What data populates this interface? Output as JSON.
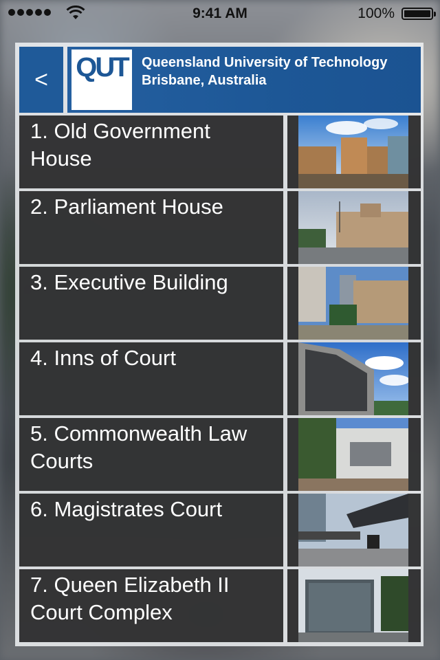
{
  "status_bar": {
    "time": "9:41 AM",
    "battery_pct": "100%"
  },
  "header": {
    "back_label": "<",
    "logo_text": "QUT",
    "university_name": "Queensland University of Technology",
    "location": "Brisbane, Australia"
  },
  "sites": [
    {
      "label": "1. Old Government House",
      "photo_icon": "old-government-house-photo"
    },
    {
      "label": "2. Parliament House",
      "photo_icon": "parliament-house-photo"
    },
    {
      "label": "3. Executive Building",
      "photo_icon": "executive-building-photo"
    },
    {
      "label": "4. Inns of Court",
      "photo_icon": "inns-of-court-photo"
    },
    {
      "label": "5. Commonwealth Law Courts",
      "photo_icon": "commonwealth-law-courts-photo"
    },
    {
      "label": "6. Magistrates Court",
      "photo_icon": "magistrates-court-photo"
    },
    {
      "label": "7. Queen Elizabeth II Court Complex",
      "photo_icon": "qeii-court-complex-photo"
    }
  ],
  "colors": {
    "brand_blue": "#1f5a99",
    "row_dark": "#1c1c1e"
  }
}
